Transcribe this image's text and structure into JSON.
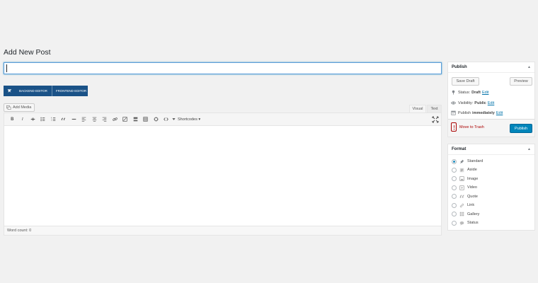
{
  "page": {
    "title": "Add New Post"
  },
  "title_field": {
    "value": ""
  },
  "builder": {
    "backend_label": "BACKEND EDITOR",
    "frontend_label": "FRONTEND EDITOR"
  },
  "media": {
    "add_media_label": "Add Media"
  },
  "editor": {
    "tabs": {
      "visual": "Visual",
      "text": "Text"
    },
    "toolbar_icons": [
      "bold-icon",
      "italic-icon",
      "strikethrough-icon",
      "bullet-list-icon",
      "numbered-list-icon",
      "blockquote-icon",
      "horizontal-rule-icon",
      "align-left-icon",
      "align-center-icon",
      "align-right-icon",
      "insert-link-icon",
      "remove-link-icon",
      "read-more-icon",
      "table-icon",
      "vc-icon",
      "code-icon"
    ],
    "bold": "B",
    "italic": "I",
    "shortcodes_label": "Shortcodes ▾",
    "word_count": "Word count: 0"
  },
  "publish": {
    "title": "Publish",
    "save_draft": "Save Draft",
    "preview": "Preview",
    "status_label": "Status:",
    "status_value": "Draft",
    "visibility_label": "Visibility:",
    "visibility_value": "Public",
    "publish_label": "Publish",
    "publish_value": "immediately",
    "edit": "Edit",
    "trash": "Move to Trash",
    "publish_button": "Publish"
  },
  "format": {
    "title": "Format",
    "options": [
      "Standard",
      "Aside",
      "Image",
      "Video",
      "Quote",
      "Link",
      "Gallery",
      "Status"
    ],
    "selected": "Standard"
  },
  "colors": {
    "accent": "#0085ba",
    "builder": "#1a5287",
    "trash": "#a00000",
    "link": "#0073aa"
  }
}
